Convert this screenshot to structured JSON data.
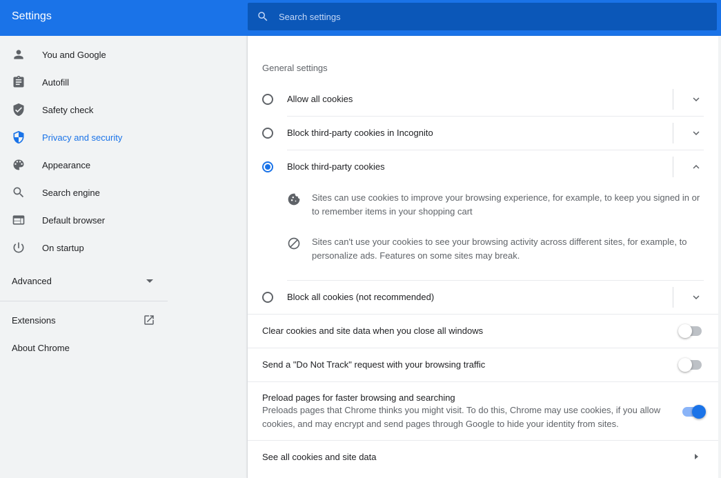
{
  "header": {
    "title": "Settings",
    "search_placeholder": "Search settings"
  },
  "sidebar": {
    "items": [
      {
        "label": "You and Google",
        "icon": "person-icon"
      },
      {
        "label": "Autofill",
        "icon": "clipboard-icon"
      },
      {
        "label": "Safety check",
        "icon": "shield-check-icon"
      },
      {
        "label": "Privacy and security",
        "icon": "shield-icon",
        "active": true
      },
      {
        "label": "Appearance",
        "icon": "palette-icon"
      },
      {
        "label": "Search engine",
        "icon": "search-icon"
      },
      {
        "label": "Default browser",
        "icon": "browser-window-icon"
      },
      {
        "label": "On startup",
        "icon": "power-icon"
      }
    ],
    "advanced_label": "Advanced",
    "extensions_label": "Extensions",
    "about_label": "About Chrome"
  },
  "content": {
    "section_title": "General settings",
    "cookie_options": [
      {
        "label": "Allow all cookies",
        "selected": false,
        "expanded": false
      },
      {
        "label": "Block third-party cookies in Incognito",
        "selected": false,
        "expanded": false
      },
      {
        "label": "Block third-party cookies",
        "selected": true,
        "expanded": true
      },
      {
        "label": "Block all cookies (not recommended)",
        "selected": false,
        "expanded": false
      }
    ],
    "details": [
      {
        "icon": "cookie-icon",
        "text": "Sites can use cookies to improve your browsing experience, for example, to keep you signed in or to remember items in your shopping cart"
      },
      {
        "icon": "block-icon",
        "text": "Sites can't use your cookies to see your browsing activity across different sites, for example, to personalize ads. Features on some sites may break."
      }
    ],
    "toggles": [
      {
        "label": "Clear cookies and site data when you close all windows",
        "on": false
      },
      {
        "label": "Send a \"Do Not Track\" request with your browsing traffic",
        "on": false
      },
      {
        "label": "Preload pages for faster browsing and searching",
        "sublabel": "Preloads pages that Chrome thinks you might visit. To do this, Chrome may use cookies, if you allow cookies, and may encrypt and send pages through Google to hide your identity from sites.",
        "on": true
      }
    ],
    "see_all_label": "See all cookies and site data"
  },
  "colors": {
    "accent": "#1a73e8",
    "header_bg": "#1a73e8",
    "search_bg": "#0b57b8"
  }
}
